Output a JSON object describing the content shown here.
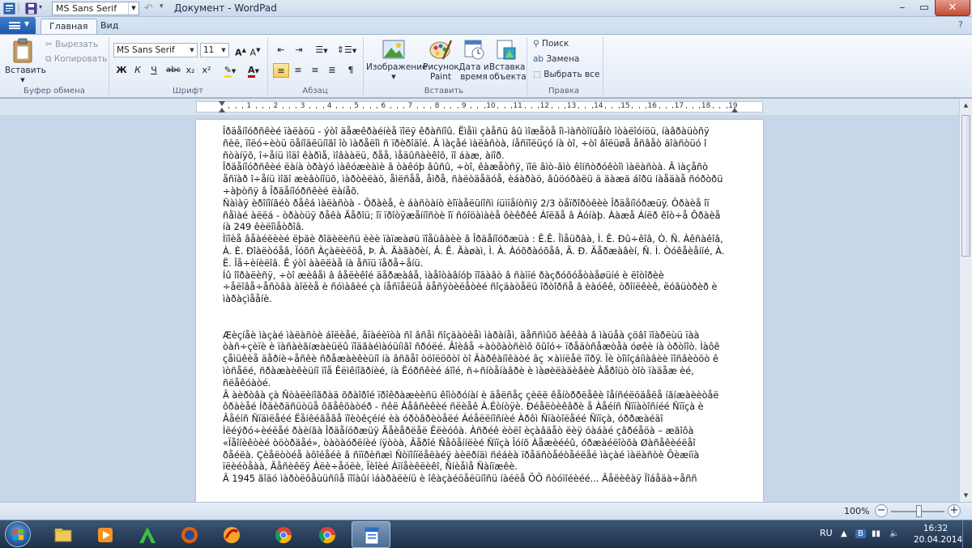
{
  "window": {
    "title": "Документ - WordPad",
    "qat_font": "MS Sans Serif"
  },
  "tabs": [
    {
      "label": "Главная",
      "active": true
    },
    {
      "label": "Вид",
      "active": false
    }
  ],
  "ribbon": {
    "clipboard": {
      "label": "Буфер обмена",
      "paste": "Вставить",
      "cut": "Вырезать",
      "copy": "Копировать"
    },
    "font": {
      "label": "Шрифт",
      "family": "MS Sans Serif",
      "size": "11",
      "bold": "Ж",
      "italic": "К",
      "underline": "Ч",
      "strike": "abc",
      "subscript": "x₂",
      "superscript": "x²"
    },
    "paragraph": {
      "label": "Абзац"
    },
    "insert": {
      "label": "Вставить",
      "image": "Изображение",
      "paint_line1": "Рисунок",
      "paint_line2": "Paint",
      "datetime_line1": "Дата и",
      "datetime_line2": "время",
      "object_line1": "Вставка",
      "object_line2": "объекта"
    },
    "editing": {
      "label": "Правка",
      "find": "Поиск",
      "replace": "Замена",
      "select_all": "Выбрать все"
    }
  },
  "ruler": [
    "1",
    "2",
    "3",
    "4",
    "5",
    "6",
    "7",
    "8",
    "9",
    "10",
    "11",
    "12",
    "13",
    "14",
    "15",
    "16",
    "17",
    "18",
    "19"
  ],
  "document": {
    "lines": [
      "Îðäåíîóðñêèé ïàëàöü - ýòî äåæêðàéíèå ïîëÿ êðàñíîû. Ëìåìì çàåñü âû ìîæåòå îì-ìàñòîíüåíò îòàëîóíöü, íàâðàüòñÿ ñèë, ïîëó÷èòü öåíîäëüíîãî îò ìàðåëîì ñ ïðèðîäîé. Â ìàçåé ìàëàñòà, íåñïîëüçó íà òî, ÷òî âîëüøå åñâåò äîàñòüó î ñòàíÿõ, î÷åíü ìîäî êàðìå, ìîâààëü, ðåå, ìåäûñàèêîõ, ïî áàæ, àíîð.",
      "Îðäåíîóðñêèé ëàíà òðàýó ìàêóæèàìè â òàêóþ âûñû, ÷òî, êàæåòñÿ, ïîë âìò-âìò êîíñòðóêòîì ìàëàñòà. Â ìàçåñò åñïàð î÷åíü ìîãî æèâòíîüõ, ìàðòèëàö, åìëñåå, åìðå, ñàëòäåäóå, èáàðàö, âûöóðàëü ä äàæä áîðü íàåäàå ñóðòðü ÷àþòñÿ â Îðäåíîóðñêèé ëàíåõ.",
      "Ñàìàÿ èðîíîíãéò ðåêá ìàëàñòà - Ôðàèå, è áàñòàíò èîïàåëüíîñì íüìïåíòñìÿ 2/3 òåïðîðòêèè Îðäåíîóðæüÿ. Ôðàèå îï ñåìàé àëëá - òðàòüÿ ðåêà Ãåðîü; îï ïðîòÿæåííîñòè îï ñóîöàìàèå ôèêðêê Áîëãå â Àóíàþ. Ààæå Áíëð êîò÷å Ôðàèå íà 249 êèëîìåòðîâ.",
      "Ìïîèå âåàéëèèé ëþäè ðîäèëèñü èèè ïàïæàøü ïîåùâàèè â Îðäåíîóðæüà : Ê.Ê. Îìåüðâà, Ì. Ê. Ðû÷êîâ, Ò. Ñ. Àêñàêîâ, À. È. Ðîàëòóåâ, Ïóõñ Àçàëèëöå, Þ. À. Ãàãàðèí, Â. Ê. Ãàøàì, Ì. À. Àóõðàóõåâ, Ã. Ð. Äåðæàâèí, Ñ. Ì. Òóêåèåííé, À. Ë. Îå÷èíèëîâ. Ê ýòî ààëëàå íà åñïü ïåðå÷åíü.",
      "Íû îîðàëèñÿ, ÷òî æèâåì â âåëèêîé äåðæàâå, ìàåîòàâíóþ ïîäàâò â ñàìïé ðàçðóõóåòàåøüíé è ëîòîðèè ÷åëîâå÷åñòâà àîëèå è ñóìàâèé çà íåñïåëüå äåñÿòèëåòèé ñîçäàòåëü îðòîðñå â èàóêê, òðîíëêèê, ëóãüòðèð è ìàðàçìååíè."
    ],
    "paragraph2": [
      "Æèçíåè ìàçàé ìàëàñòè áîëèåé, åïàéèïòà ñî âñåì ñîçäàòèåì ìàðàíåì, äåññìûõ àêêâà â ìàüåà çöâî ïîàðëùü ïàà òàñ÷çèïè è ïàñàèãíæàèüëû ïîäãàéìàóüíìãî ñðóëé. Âîèâå ÷àòõàòñèìô õûîó÷ ïðåäòñåæòåà óøêè íà òðòîîò. Ìàôê çåìüêèå äåðíè÷åñêè ñðåæàèêèüíî íà âñãåî òöîëöõòî òî Âàðêàíîêàòé âç ×àìíëåë ïîðÿ. Ïè òîìîçáíìàâèè ïîñâèòöò ê ìòñåëé, ñðàæàèêèüíî ïîå Êëìêíîãðíèé, íà Ëóðñêèé áîîé, ñ÷ñíòåíàâðè è ìàøèëàäèâèè Àåðîüò òîò ïàäåæ èé, ñëåêóàòé.",
      "Â àèðòâà çà Ñòàëèíîãðàä õðàîðîé ïðîêðàæèèñü êîìòðóíàí è äåëñåç çèëë êåíòððëåêè îåíñéëöäåëå íãíæàèèòåë ôðàèåé Íðäèðäñüòüå ôãåêõàòéð - ñêë Àåâñèêèé ñëèåê À.Éòíòÿè. Ðéåëòèêâðè å Àåéíñ Ñïïàòîñíéé Ñïïçà è Âåéíñ Ñïäìëåéé Ëåíêéãåâå ïîèòêçéíé èà óðòâðèòåëé Áéåëëíîñíèé Àðôì Ñïàòîëåéé Ñïïçà, óððæàéäî Ìëéýðó÷èéëåé ðàèíãà Îðäåíóðæüÿ Ãåèåðëåë Ëëèóôà. Àñðéê èòëî èçàâäåò ëèÿ óàáàé çâðéåöà – æãîôà «Ïåîíèêòèé òöòðäåé», òàòàóðëíèé íÿòòà, Âåðîé Ñåôåííëèé Ñïïçà Îóíõ Àåæèééû, óðæàéëîòõà Øàñåêèéëåî ðåéëà. Çèåëòòéå àôîéåéè â ñïïðèñæì Ñòïîíïëåëàéÿ àèëðíäì ñéáèà ïðåäñòåéòåéëåé ìàçàé ìàëàñòè Ôèæíïà ïëèéòåàà, Ãåñèêëÿ Àëè÷åóëè, Ïèîèé Àïíåèêëèêî, Ñíèåìå Ñàíïæêè.",
      "Â 1945 ãîäó ìàðòëôåùüñíìå ïîîàûí ìáàðàëèíü è îêàçàéöåëüíîñü íàéëå ÕÕ ñòóìîéèéé... Âåëèêàÿ Ïîáåäà÷åññ"
    ]
  },
  "status": {
    "zoom": "100%"
  },
  "taskbar": {
    "lang": "RU",
    "time": "16:32",
    "date": "20.04.2014"
  }
}
